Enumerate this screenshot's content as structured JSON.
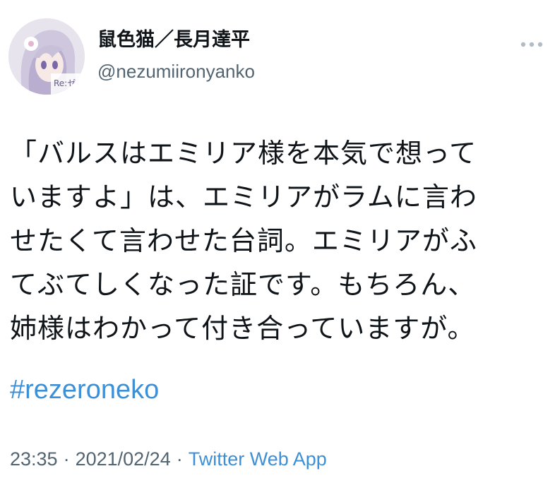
{
  "tweet": {
    "author": {
      "display_name": "鼠色猫／長月達平",
      "handle": "@nezumiironyanko",
      "avatar_icon": "anime-character-avatar"
    },
    "more_icon": "more-options-icon",
    "text_lines": [
      "「バルスはエミリア様を本気で想って",
      "いますよ」は、エミリアがラムに言わ",
      "せたくて言わせた台詞。エミリアがふ",
      "てぶてしくなった証です。もちろん、",
      "姉様はわかって付き合っていますが。"
    ],
    "hashtag": "#rezeroneko",
    "meta": {
      "time": "23:35",
      "separator": "·",
      "date": "2021/02/24",
      "source": "Twitter Web App"
    },
    "colors": {
      "link": "#3d8fd6",
      "secondary_text": "#536471",
      "primary_text": "#0f1419"
    }
  }
}
